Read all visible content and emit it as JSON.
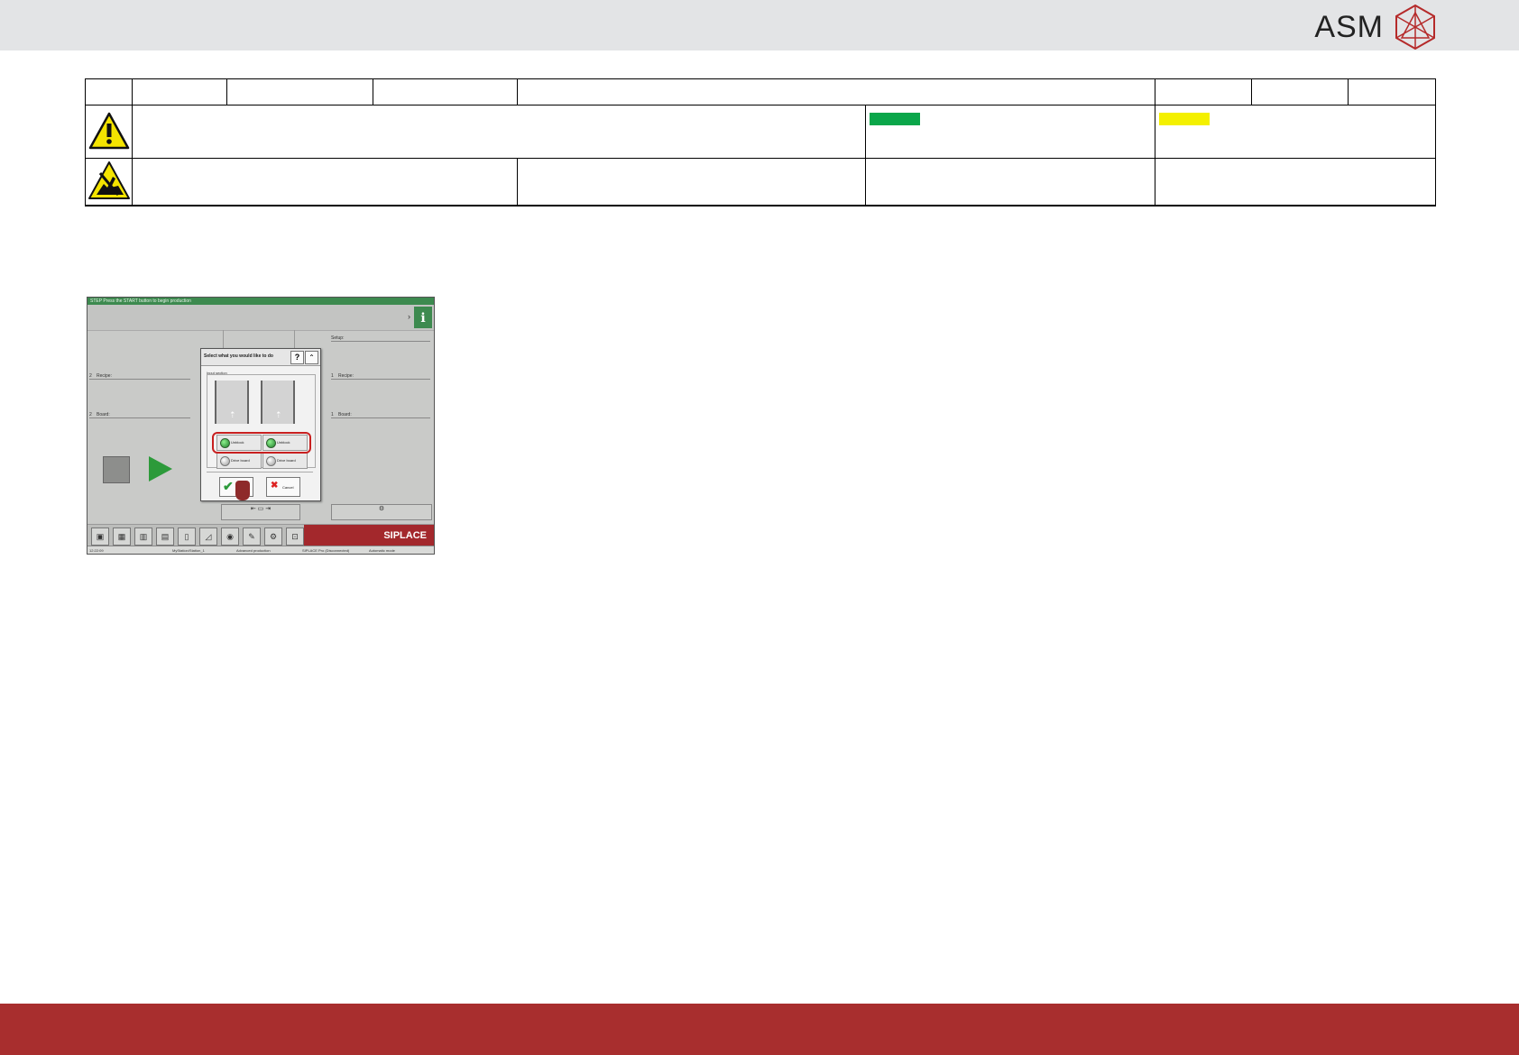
{
  "brand": {
    "logo_text": "ASM",
    "colors": {
      "topbar": "#e3e4e6",
      "footer": "#a82e2e",
      "green_mark": "#0aa64a",
      "yellow_mark": "#f4f000"
    }
  },
  "header_table": {
    "warning_icon": "warning-triangle-icon",
    "esd_icon": "esd-hand-icon"
  },
  "screenshot": {
    "title_bar": "STEP Press the START button to begin production",
    "left_recipe_label": "Recipe:",
    "left_board_label": "Board:",
    "right_setup_label": "Setup:",
    "right_recipe_label": "Recipe:",
    "right_board_label": "Board:",
    "lane_num_2": "2",
    "lane_num_1": "1",
    "brand_text": "SIPLACE",
    "dialog": {
      "title": "Select what you would like to do",
      "help_label": "?",
      "section_label": "Input section",
      "unblock_left": "Unblock",
      "unblock_right": "Unblock",
      "drive_left": "Drive board",
      "drive_right": "Drive board",
      "cancel_label": "Cancel"
    },
    "status_bar": {
      "time": "12:22:09",
      "station": "MyStation/Station_1",
      "mode": "Advanced production",
      "pro": "SIPLACE Pro (Disconnected)",
      "auto": "Automatic mode"
    }
  }
}
